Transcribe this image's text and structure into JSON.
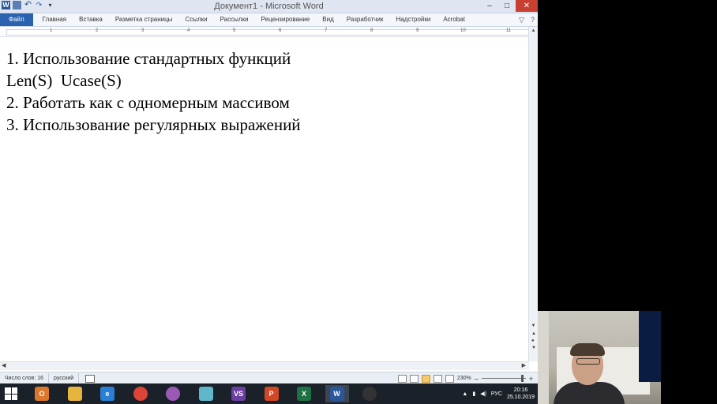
{
  "window": {
    "title": "Документ1 - Microsoft Word",
    "controls": {
      "minimize": "–",
      "maximize": "□",
      "close": "✕"
    }
  },
  "qat": {
    "app_icon": "W",
    "undo": "↶",
    "redo": "↷",
    "more": "▾"
  },
  "ribbon": {
    "tabs": [
      "Файл",
      "Главная",
      "Вставка",
      "Разметка страницы",
      "Ссылки",
      "Рассылки",
      "Рецензирование",
      "Вид",
      "Разработчик",
      "Надстройки",
      "Acrobat"
    ],
    "right": {
      "collapse": "▽",
      "help": "?"
    }
  },
  "ruler": {
    "numbers": [
      "1",
      "2",
      "3",
      "4",
      "5",
      "6",
      "7",
      "8",
      "9",
      "10",
      "11"
    ]
  },
  "document": {
    "lines": [
      "1. Использование стандартных функций",
      "Len(S)  Ucase(S)",
      "2. Работать как с одномерным массивом",
      "3. Использование регулярных выражений"
    ]
  },
  "statusbar": {
    "words": "Число слов: 16",
    "language": "русский",
    "zoom": "230%",
    "zoom_out": "–",
    "zoom_in": "+"
  },
  "taskbar": {
    "apps": [
      {
        "name": "outlook",
        "label": "O",
        "color": "#d9772b"
      },
      {
        "name": "explorer",
        "label": "",
        "color": "#e7b53b"
      },
      {
        "name": "ie",
        "label": "e",
        "color": "#2a7fd4"
      },
      {
        "name": "chrome",
        "label": "",
        "color": "#db4437"
      },
      {
        "name": "picasa",
        "label": "",
        "color": "#9b59b6"
      },
      {
        "name": "app",
        "label": "",
        "color": "#5fb7c9"
      },
      {
        "name": "visual-studio",
        "label": "VS",
        "color": "#6b3fa0"
      },
      {
        "name": "powerpoint",
        "label": "P",
        "color": "#d24726"
      },
      {
        "name": "excel",
        "label": "X",
        "color": "#1e7145"
      },
      {
        "name": "word",
        "label": "W",
        "color": "#2b579a"
      },
      {
        "name": "obs",
        "label": "",
        "color": "#333"
      }
    ],
    "tray": {
      "lang": "РУС",
      "time": "20:16",
      "date": "25.10.2019",
      "chevron": "▲"
    }
  }
}
